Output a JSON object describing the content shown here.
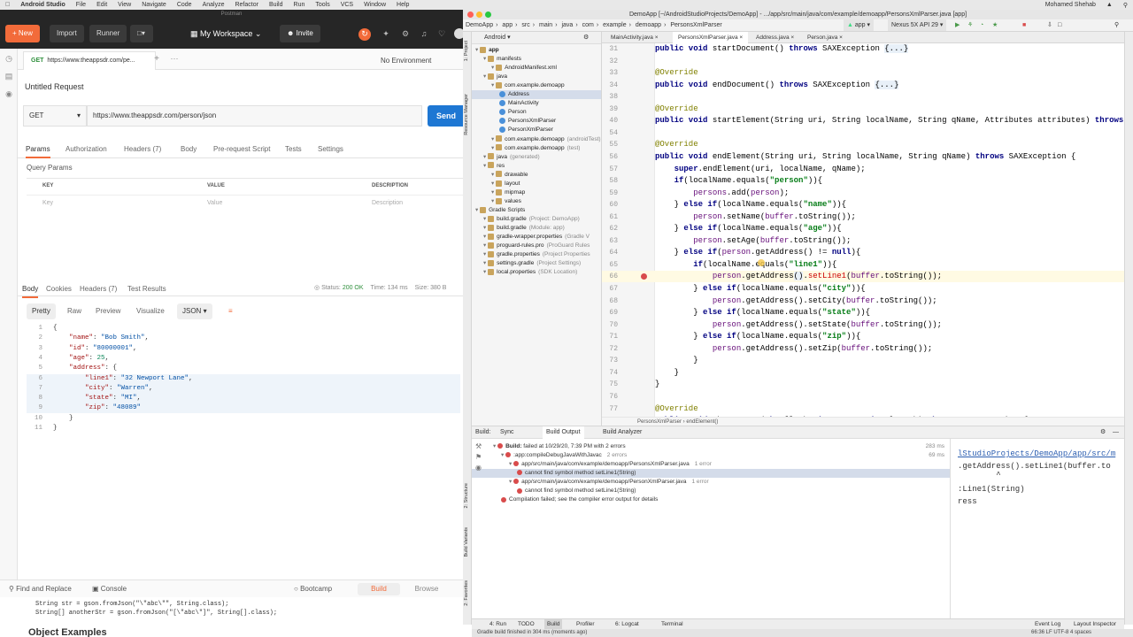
{
  "menubar": {
    "apple": "",
    "app": "Android Studio",
    "items": [
      "File",
      "Edit",
      "View",
      "Navigate",
      "Code",
      "Analyze",
      "Refactor",
      "Build",
      "Run",
      "Tools",
      "VCS",
      "Window",
      "Help"
    ],
    "user": "Mohamed Shehab"
  },
  "postman": {
    "window_title": "Postman",
    "new_label": "New",
    "import_label": "Import",
    "runner_label": "Runner",
    "workspace": "My Workspace",
    "invite": "Invite",
    "tab": {
      "method": "GET",
      "url": "https://www.theappsdr.com/pe..."
    },
    "env": "No Environment",
    "title": "Untitled Request",
    "method": "GET",
    "url": "https://www.theappsdr.com/person/json",
    "send": "Send",
    "req_tabs": [
      "Params",
      "Authorization",
      "Headers (7)",
      "Body",
      "Pre-request Script",
      "Tests",
      "Settings"
    ],
    "query_params": "Query Params",
    "columns": [
      "KEY",
      "VALUE",
      "DESCRIPTION"
    ],
    "placeholders": [
      "Key",
      "Value",
      "Description"
    ],
    "resp_tabs": [
      "Body",
      "Cookies",
      "Headers (7)",
      "Test Results"
    ],
    "status_label": "Status:",
    "status_value": "200 OK",
    "time": "Time: 134 ms",
    "size": "Size: 380 B",
    "view_modes": [
      "Pretty",
      "Raw",
      "Preview",
      "Visualize"
    ],
    "format": "JSON",
    "json_lines": [
      {
        "n": "1",
        "t": "{"
      },
      {
        "n": "2",
        "k": "\"name\"",
        "v": "\"Bob Smith\"",
        "c": ","
      },
      {
        "n": "3",
        "k": "\"id\"",
        "v": "\"80000001\"",
        "c": ","
      },
      {
        "n": "4",
        "k": "\"age\"",
        "num": "25",
        "c": ","
      },
      {
        "n": "5",
        "k": "\"address\"",
        "t2": ": {"
      },
      {
        "n": "6",
        "k": "\"line1\"",
        "v": "\"32 Newport Lane\"",
        "c": ","
      },
      {
        "n": "7",
        "k": "\"city\"",
        "v": "\"Warren\"",
        "c": ","
      },
      {
        "n": "8",
        "k": "\"state\"",
        "v": "\"MI\"",
        "c": ","
      },
      {
        "n": "9",
        "k": "\"zip\"",
        "v": "\"48089\""
      },
      {
        "n": "10",
        "t": "}"
      },
      {
        "n": "11",
        "t": "}"
      }
    ],
    "footer": {
      "find": "Find and Replace",
      "console": "Console",
      "bootcamp": "Bootcamp",
      "build": "Build",
      "browse": "Browse"
    },
    "docs_lines": [
      "String str = gson.fromJson(\"\\\"abc\\\"\", String.class);",
      "String[] anotherStr = gson.fromJson(\"[\\\"abc\\\"]\", String[].class);"
    ],
    "docs_heading": "Object Examples"
  },
  "studio": {
    "title": "DemoApp [~/AndroidStudioProjects/DemoApp] - .../app/src/main/java/com/example/demoapp/PersonsXmlParser.java [app]",
    "nav": [
      "DemoApp",
      "app",
      "src",
      "main",
      "java",
      "com",
      "example",
      "demoapp",
      "PersonsXmlParser"
    ],
    "run_config": "app",
    "device": "Nexus 5X API 29",
    "project_view": "Android",
    "tree": [
      {
        "d": 0,
        "t": "app",
        "b": true
      },
      {
        "d": 1,
        "t": "manifests"
      },
      {
        "d": 2,
        "t": "AndroidManifest.xml"
      },
      {
        "d": 1,
        "t": "java"
      },
      {
        "d": 2,
        "t": "com.example.demoapp"
      },
      {
        "d": 3,
        "t": "Address",
        "sel": true
      },
      {
        "d": 3,
        "t": "MainActivity"
      },
      {
        "d": 3,
        "t": "Person"
      },
      {
        "d": 3,
        "t": "PersonsXmlParser"
      },
      {
        "d": 3,
        "t": "PersonXmlParser"
      },
      {
        "d": 2,
        "t": "com.example.demoapp",
        "g": "(androidTest)"
      },
      {
        "d": 2,
        "t": "com.example.demoapp",
        "g": "(test)"
      },
      {
        "d": 1,
        "t": "java",
        "g": "(generated)"
      },
      {
        "d": 1,
        "t": "res"
      },
      {
        "d": 2,
        "t": "drawable"
      },
      {
        "d": 2,
        "t": "layout"
      },
      {
        "d": 2,
        "t": "mipmap"
      },
      {
        "d": 2,
        "t": "values"
      },
      {
        "d": 0,
        "t": "Gradle Scripts"
      },
      {
        "d": 1,
        "t": "build.gradle",
        "g": "(Project: DemoApp)"
      },
      {
        "d": 1,
        "t": "build.gradle",
        "g": "(Module: app)"
      },
      {
        "d": 1,
        "t": "gradle-wrapper.properties",
        "g": "(Gradle V"
      },
      {
        "d": 1,
        "t": "proguard-rules.pro",
        "g": "(ProGuard Rules"
      },
      {
        "d": 1,
        "t": "gradle.properties",
        "g": "(Project Properties"
      },
      {
        "d": 1,
        "t": "settings.gradle",
        "g": "(Project Settings)"
      },
      {
        "d": 1,
        "t": "local.properties",
        "g": "(SDK Location)"
      }
    ],
    "editor_tabs": [
      "MainActivity.java",
      "PersonsXmlParser.java",
      "Address.java",
      "Person.java"
    ],
    "code": [
      {
        "n": "31",
        "h": "<span class=\"kw\">public void</span> startDocument() <span class=\"kw\">throws</span> SAXException <span class=\"fd\">{...}</span>"
      },
      {
        "n": "32",
        "h": ""
      },
      {
        "n": "33",
        "h": "<span class=\"an\">@Override</span>"
      },
      {
        "n": "34",
        "h": "<span class=\"kw\">public void</span> endDocument() <span class=\"kw\">throws</span> SAXException <span class=\"fd\">{...}</span>"
      },
      {
        "n": "38",
        "h": ""
      },
      {
        "n": "39",
        "h": "<span class=\"an\">@Override</span>"
      },
      {
        "n": "40",
        "h": "<span class=\"kw\">public void</span> startElement(String uri, String localName, String qName, Attributes attributes) <span class=\"kw\">throws</span>"
      },
      {
        "n": "54",
        "h": ""
      },
      {
        "n": "55",
        "h": "<span class=\"an\">@Override</span>"
      },
      {
        "n": "56",
        "h": "<span class=\"kw\">public void</span> endElement(String uri, String localName, String qName) <span class=\"kw\">throws</span> SAXException {"
      },
      {
        "n": "57",
        "h": "    <span class=\"kw\">super</span>.endElement(uri, localName, qName);"
      },
      {
        "n": "58",
        "h": "    <span class=\"kw\">if</span>(localName.equals(<span class=\"st\">\"person\"</span>)){"
      },
      {
        "n": "59",
        "h": "        <span class=\"fo\">persons</span>.add(<span class=\"fo\">person</span>);"
      },
      {
        "n": "60",
        "h": "    } <span class=\"kw\">else if</span>(localName.equals(<span class=\"st\">\"name\"</span>)){"
      },
      {
        "n": "61",
        "h": "        <span class=\"fo\">person</span>.setName(<span class=\"fo\">buffer</span>.toString());"
      },
      {
        "n": "62",
        "h": "    } <span class=\"kw\">else if</span>(localName.equals(<span class=\"st\">\"age\"</span>)){"
      },
      {
        "n": "63",
        "h": "        <span class=\"fo\">person</span>.setAge(<span class=\"fo\">buffer</span>.toString());"
      },
      {
        "n": "64",
        "h": "    } <span class=\"kw\">else if</span>(<span class=\"fo\">person</span>.getAddress() != <span class=\"kw\">null</span>){"
      },
      {
        "n": "65",
        "h": "        <span class=\"kw\">if</span>(localName.equals(<span class=\"st\">\"line1\"</span>)){"
      },
      {
        "n": "66",
        "h": "            <span class=\"fo\">person</span>.getAddress<span class=\"fd\">()</span>.<span style=\"color:#c00\">setLine1</span>(<span class=\"fo\">buffer</span>.toString());",
        "cur": true
      },
      {
        "n": "67",
        "h": "        } <span class=\"kw\">else if</span>(localName.equals(<span class=\"st\">\"city\"</span>)){"
      },
      {
        "n": "68",
        "h": "            <span class=\"fo\">person</span>.getAddress().setCity(<span class=\"fo\">buffer</span>.toString());"
      },
      {
        "n": "69",
        "h": "        } <span class=\"kw\">else if</span>(localName.equals(<span class=\"st\">\"state\"</span>)){"
      },
      {
        "n": "70",
        "h": "            <span class=\"fo\">person</span>.getAddress().setState(<span class=\"fo\">buffer</span>.toString());"
      },
      {
        "n": "71",
        "h": "        } <span class=\"kw\">else if</span>(localName.equals(<span class=\"st\">\"zip\"</span>)){"
      },
      {
        "n": "72",
        "h": "            <span class=\"fo\">person</span>.getAddress().setZip(<span class=\"fo\">buffer</span>.toString());"
      },
      {
        "n": "73",
        "h": "        }"
      },
      {
        "n": "74",
        "h": "    }"
      },
      {
        "n": "75",
        "h": "}"
      },
      {
        "n": "76",
        "h": ""
      },
      {
        "n": "77",
        "h": "<span class=\"an\">@Override</span>"
      },
      {
        "n": "78",
        "h": "<span class=\"kw\">public void</span> characters(<span class=\"kw\">char</span>[] ch, <span class=\"kw\">int</span> start, <span class=\"kw\">int</span> length) <span class=\"kw\">throws</span> SAXException {"
      }
    ],
    "breadcrumb": "PersonsXmlParser  ›  endElement()",
    "build": {
      "tabs": [
        "Build:",
        "Sync",
        "Build Output",
        "Build Analyzer"
      ],
      "rows": [
        {
          "d": 0,
          "t": "Build:",
          "t2": " failed at 10/29/20, 7:39 PM with 2 errors",
          "time": "283 ms"
        },
        {
          "d": 1,
          "t": ":app:compileDebugJavaWithJavac",
          "g": "2 errors",
          "time": "69 ms"
        },
        {
          "d": 2,
          "t": "app/src/main/java/com/example/demoapp/PersonsXmlParser.java",
          "g": "1 error"
        },
        {
          "d": 3,
          "t": "cannot find symbol method setLine1(String)",
          "sel": true
        },
        {
          "d": 2,
          "t": "app/src/main/java/com/example/demoapp/PersonXmlParser.java",
          "g": "1 error"
        },
        {
          "d": 3,
          "t": "cannot find symbol method setLine1(String)"
        },
        {
          "d": 1,
          "t": "Compilation failed; see the compiler error output for details"
        }
      ],
      "detail": [
        "lStudioProjects/DemoApp/app/src/m",
        ".getAddress().setLine1(buffer.to",
        "        ^",
        ":Line1(String)",
        "ress"
      ]
    },
    "toolwindows": [
      "4: Run",
      "TODO",
      "Build",
      "Profiler",
      "6: Logcat",
      "Terminal"
    ],
    "toolwindows_right": [
      "Event Log",
      "Layout Inspector"
    ],
    "left_strip": [
      "1: Project",
      "Resource Manager",
      "2: Structure",
      "Build Variants",
      "2: Favorites"
    ],
    "status_left": "Gradle build finished in 304 ms (moments ago)",
    "status_right": "66:36  LF  UTF-8  4 spaces"
  }
}
